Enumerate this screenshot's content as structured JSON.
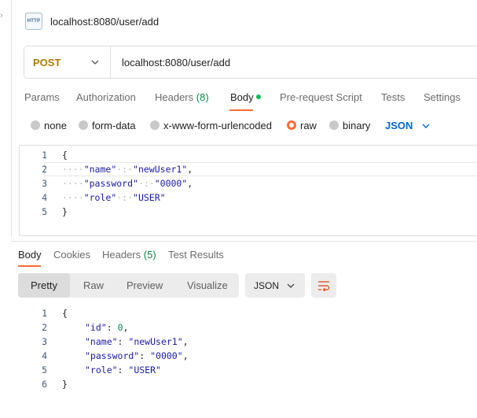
{
  "tab": {
    "title": "localhost:8080/user/add",
    "badge": "HTTP"
  },
  "request": {
    "method": "POST",
    "url": "localhost:8080/user/add",
    "tabs": [
      {
        "label": "Params"
      },
      {
        "label": "Authorization"
      },
      {
        "label": "Headers",
        "count": "(8)"
      },
      {
        "label": "Body"
      },
      {
        "label": "Pre-request Script"
      },
      {
        "label": "Tests"
      },
      {
        "label": "Settings"
      }
    ],
    "body_types": [
      "none",
      "form-data",
      "x-www-form-urlencoded",
      "raw",
      "binary"
    ],
    "selected_body_type": "raw",
    "raw_format": "JSON",
    "body_lines": [
      {
        "n": "1",
        "text": "{"
      },
      {
        "n": "2",
        "ws": "····",
        "key": "\"name\"",
        "sep": "·:·",
        "val": "\"newUser1\"",
        "end": ","
      },
      {
        "n": "3",
        "ws": "····",
        "key": "\"password\"",
        "sep": "·:·",
        "val": "\"0000\"",
        "end": ","
      },
      {
        "n": "4",
        "ws": "····",
        "key": "\"role\"",
        "sep": "·:·",
        "val": "\"USER\"",
        "end": ""
      },
      {
        "n": "5",
        "text": "}"
      }
    ]
  },
  "response": {
    "tabs": [
      {
        "label": "Body"
      },
      {
        "label": "Cookies"
      },
      {
        "label": "Headers",
        "count": "(5)"
      },
      {
        "label": "Test Results"
      }
    ],
    "view_modes": [
      "Pretty",
      "Raw",
      "Preview",
      "Visualize"
    ],
    "selected_view": "Pretty",
    "format": "JSON",
    "body_lines": [
      {
        "n": "1",
        "text": "{"
      },
      {
        "n": "2",
        "key": "\"id\"",
        "sep": ": ",
        "val": "0",
        "end": ",",
        "num": true
      },
      {
        "n": "3",
        "key": "\"name\"",
        "sep": ": ",
        "val": "\"newUser1\"",
        "end": ","
      },
      {
        "n": "4",
        "key": "\"password\"",
        "sep": ": ",
        "val": "\"0000\"",
        "end": ","
      },
      {
        "n": "5",
        "key": "\"role\"",
        "sep": ": ",
        "val": "\"USER\"",
        "end": ""
      },
      {
        "n": "6",
        "text": "}"
      }
    ]
  },
  "colors": {
    "accent": "#ff6c37",
    "method": "#ad7a03",
    "link": "#0265d2",
    "dot": "#0cbb52"
  },
  "icons": [
    "http-icon",
    "chevron-down-icon",
    "wrap-lines-icon"
  ]
}
